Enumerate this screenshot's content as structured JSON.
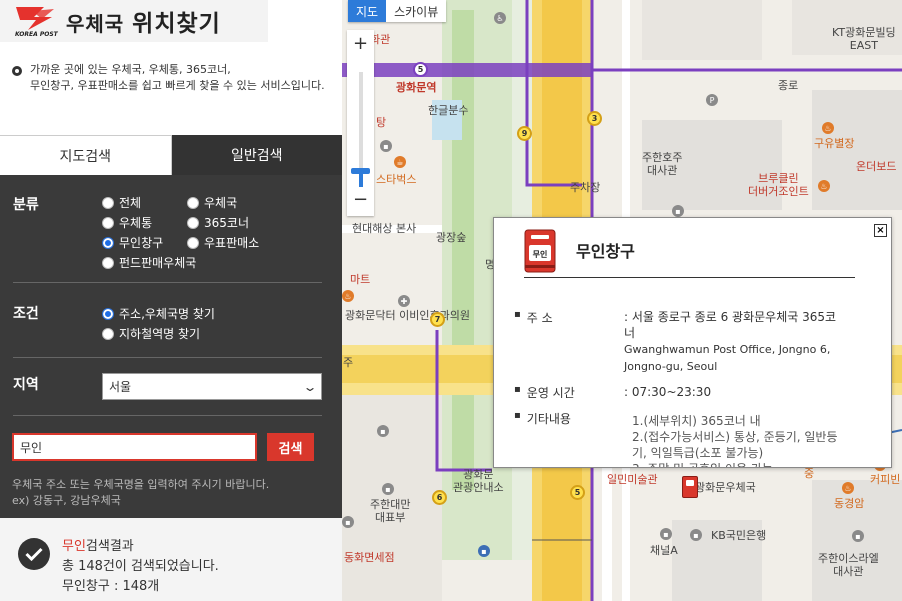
{
  "header": {
    "logo_sub": "KOREA POST",
    "title_prefix": "우체국",
    "title_main": "위치찾기"
  },
  "intro": "가까운 곳에 있는 우체국, 우체통, 365코너,\n무인창구, 우표판매소를 쉽고 빠르게 찾을 수 있는 서비스입니다.",
  "tabs": [
    {
      "label": "지도검색",
      "active": false
    },
    {
      "label": "일반검색",
      "active": true
    }
  ],
  "category": {
    "label": "분류",
    "options": [
      {
        "label": "전체",
        "checked": false
      },
      {
        "label": "우체국",
        "checked": false
      },
      {
        "label": "우체통",
        "checked": false
      },
      {
        "label": "365코너",
        "checked": false
      },
      {
        "label": "무인창구",
        "checked": true
      },
      {
        "label": "우표판매소",
        "checked": false
      },
      {
        "label": "펀드판매우체국",
        "checked": false
      }
    ]
  },
  "condition": {
    "label": "조건",
    "options": [
      {
        "label": "주소,우체국명 찾기",
        "checked": true
      },
      {
        "label": "지하철역명 찾기",
        "checked": false
      }
    ]
  },
  "region": {
    "label": "지역",
    "selected": "서울"
  },
  "search": {
    "value": "무인",
    "button": "검색",
    "hint": "우체국 주소 또는 우체국명을 입력하여 주시기 바랍니다.\nex) 강동구, 강남우체국"
  },
  "result": {
    "keyword": "무인",
    "suffix": "검색결과",
    "line2": "총 148건이 검색되었습니다.",
    "line3": "무인창구 : 148개"
  },
  "map": {
    "type_buttons": [
      "지도",
      "스카이뷰"
    ],
    "zoom_in": "+",
    "zoom_out": "−",
    "zoom_level": 0.14,
    "labels": {
      "l1": "화관",
      "l2": "광화문역",
      "l3": "한글분수",
      "l4": "탕",
      "l5": "스타벅스",
      "l6": "현대해상\n본사",
      "l7": "광장숲",
      "l8": "광화문닥터\n이비인후과의원",
      "l9": "KT광화문빌딩\nEAST",
      "l10": "주한호주\n대사관",
      "l11": "주차장",
      "l12": "온더보드",
      "l13": "브루클린\n더버거조인트",
      "l14": "구유별장",
      "l15": "광화문\n관광안내소",
      "l16": "주한대만\n대표부",
      "l17": "동화면세점",
      "l18": "일민미술관",
      "l19": "광화문우체국",
      "l20": "KB국민은행",
      "l21": "채널A",
      "l22": "주한이스라엘\n대사관",
      "l23": "커피빈",
      "l24": "동경암",
      "l25": "종로",
      "l26": "명",
      "l27": "마트",
      "l28": "중",
      "l29": "주"
    },
    "route_numbers": [
      "5",
      "3",
      "9",
      "7",
      "6",
      "5"
    ]
  },
  "popup": {
    "title": "무인창구",
    "icon_text": "무인",
    "close": "×",
    "rows": [
      {
        "label": "주 소",
        "value": ": 서울 종로구 종로 6 광화문우체국 365코너",
        "value_en": "Gwanghwamun Post Office, Jongno 6, Jongno-gu, Seoul"
      },
      {
        "label": "운영 시간",
        "value": ": 07:30~23:30"
      },
      {
        "label": "기타내용",
        "value": "1.(세부위치) 365코너 내\n2.(접수가능서비스) 통상, 준등기, 일반등기, 익일특급(소포 불가능)\n3. 주말 및 공휴일 이용 가능"
      }
    ],
    "bullet": "▪"
  },
  "colors": {
    "accent_red": "#d9372c",
    "panel_dark": "#3a3a3a",
    "map_blue": "#2d7bd9",
    "route_purple": "#7b3fbf"
  }
}
